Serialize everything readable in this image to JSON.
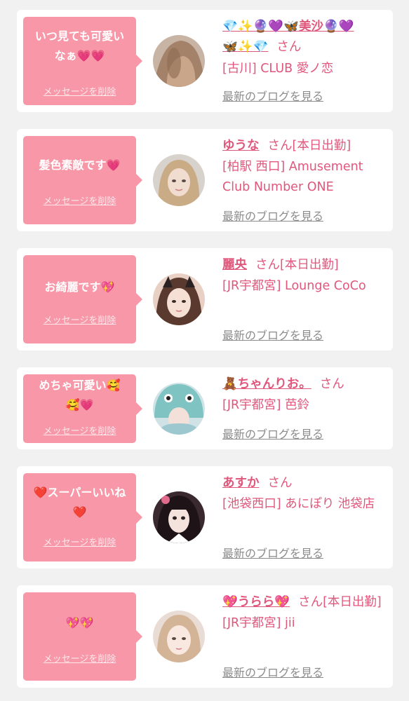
{
  "cards": [
    {
      "message": "いつ見ても可愛い\nなぁ💗💗",
      "delete_label": "メッセージを削除",
      "name": "💎✨🔮💜🦋美沙🔮💜\n🦋✨💎",
      "honorific": "さん",
      "status": "",
      "shop": "[古川] CLUB 愛ノ恋",
      "blog_label": "最新のブログを見る"
    },
    {
      "message": "髪色素敵です💗",
      "delete_label": "メッセージを削除",
      "name": "ゆうな",
      "honorific": "さん",
      "status": "[本日出勤]",
      "shop": "[柏駅 西口] Amusement Club Number ONE",
      "blog_label": "最新のブログを見る"
    },
    {
      "message": "お綺麗です💖",
      "delete_label": "メッセージを削除",
      "name": "麗央",
      "honorific": "さん",
      "status": "[本日出勤]",
      "shop": "[JR宇都宮] Lounge CoCo",
      "blog_label": "最新のブログを見る"
    },
    {
      "message": "めちゃ可愛い🥰\n🥰💗",
      "delete_label": "メッセージを削除",
      "name": "🧸ちゃんりお。",
      "honorific": "さん",
      "status": "",
      "shop": "[JR宇都宮] 芭鈴",
      "blog_label": "最新のブログを見る"
    },
    {
      "message": "❤️スーパーいいね\n❤️",
      "delete_label": "メッセージを削除",
      "name": "あすか",
      "honorific": "さん",
      "status": "",
      "shop": "[池袋西口] あにぽり 池袋店",
      "blog_label": "最新のブログを見る"
    },
    {
      "message": "💖💖",
      "delete_label": "メッセージを削除",
      "name": "💖うらら💖",
      "honorific": "さん",
      "status": "[本日出勤]",
      "shop": "[JR宇都宮] jii",
      "blog_label": "最新のブログを見る"
    }
  ],
  "colors": {
    "bubble": "#f797a8",
    "accent_text": "#e0577c",
    "link_gray": "#8c8c8c",
    "background": "#f1f1f1"
  }
}
